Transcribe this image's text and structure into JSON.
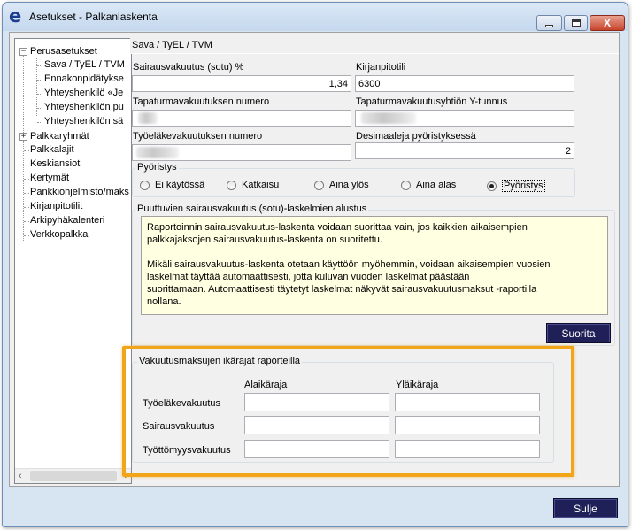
{
  "window": {
    "title": "Asetukset - Palkanlaskenta",
    "icon_letter": "e",
    "close_label": "X"
  },
  "tree": {
    "items": [
      {
        "label": "Perusasetukset",
        "expander": "−"
      },
      {
        "label": "Sava / TyEL / TVM"
      },
      {
        "label": "Ennakonpidätykse"
      },
      {
        "label": "Yhteyshenkilö «Je"
      },
      {
        "label": "Yhteyshenkilön pu"
      },
      {
        "label": "Yhteyshenkilön sä"
      },
      {
        "label": "Palkkaryhmät",
        "expander": "+"
      },
      {
        "label": "Palkkalajit"
      },
      {
        "label": "Keskiansiot"
      },
      {
        "label": "Kertymät"
      },
      {
        "label": "Pankkiohjelmisto/maks"
      },
      {
        "label": "Kirjanpitotilit"
      },
      {
        "label": "Arkipyhäkalenteri"
      },
      {
        "label": "Verkkopalkka"
      }
    ],
    "scroll_left": "‹",
    "scroll_right": "›"
  },
  "panel": {
    "header": "Sava / TyEL / TVM",
    "fields": {
      "sotu_label": "Sairausvakuutus (sotu) %",
      "sotu_value": "1,34",
      "kirjanpitotili_label": "Kirjanpitotili",
      "kirjanpitotili_value": "6300",
      "tapaturma_nro_label": "Tapaturmavakuutuksen numero",
      "tapaturma_ytunnus_label": "Tapaturmavakuutusyhtiön Y-tunnus",
      "tyelake_nro_label": "Työeläkevakuutuksen numero",
      "desimaaleja_label": "Desimaaleja pyöristyksessä",
      "desimaaleja_value": "2"
    },
    "rounding": {
      "title": "Pyöristys",
      "options": [
        {
          "label": "Ei käytössä",
          "checked": false
        },
        {
          "label": "Katkaisu",
          "checked": false
        },
        {
          "label": "Aina ylös",
          "checked": false
        },
        {
          "label": "Aina alas",
          "checked": false
        },
        {
          "label": "Pyöristys",
          "checked": true
        }
      ]
    },
    "init": {
      "title": "Puuttuvien sairausvakuutus (sotu)-laskelmien alustus",
      "para1_line1": "Raportoinnin sairausvakuutus-laskenta voidaan suorittaa vain, jos kaikkien aikaisempien",
      "para1_line2": "palkkajaksojen sairausvakuutus-laskenta on suoritettu.",
      "para2_line1": "Mikäli sairausvakuutus-laskenta otetaan käyttöön myöhemmin, voidaan aikaisempien vuosien",
      "para2_line2": "laskelmat täyttää  automaattisesti, jotta kuluvan vuoden laskelmat päästään",
      "para2_line3": "suorittamaan. Automaattisesti täytetyt laskelmat näkyvät sairausvakuutusmaksut -raportilla",
      "para2_line4": "nollana.",
      "button": "Suorita"
    },
    "age_limits": {
      "title": "Vakuutusmaksujen ikärajat raporteilla",
      "col_lower": "Alaikäraja",
      "col_upper": "Yläikäraja",
      "rows": [
        {
          "label": "Työeläkevakuutus",
          "lower": "",
          "upper": ""
        },
        {
          "label": "Sairausvakuutus",
          "lower": "",
          "upper": ""
        },
        {
          "label": "Työttömyysvakuutus",
          "lower": "",
          "upper": ""
        }
      ]
    }
  },
  "footer": {
    "close_button": "Sulje"
  },
  "colors": {
    "highlight": "#f3a51a",
    "dark_button": "#1f2057",
    "info_background": "#ffffe1"
  }
}
